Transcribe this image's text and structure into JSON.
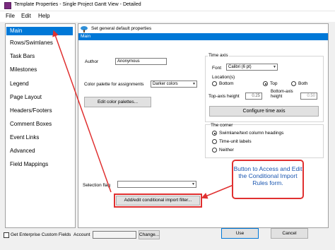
{
  "window": {
    "title": "Template Properties - Single Project Gantt View - Detailed"
  },
  "menu": {
    "file": "File",
    "edit": "Edit",
    "help": "Help"
  },
  "sidebar": {
    "items": [
      {
        "label": "Main"
      },
      {
        "label": "Rows/Swimlanes"
      },
      {
        "label": "Task Bars"
      },
      {
        "label": "Milestones"
      },
      {
        "label": "Legend"
      },
      {
        "label": "Page Layout"
      },
      {
        "label": "Headers/Footers"
      },
      {
        "label": "Comment Boxes"
      },
      {
        "label": "Event Links"
      },
      {
        "label": "Advanced"
      },
      {
        "label": "Field Mappings"
      }
    ],
    "selected": "Main"
  },
  "panel": {
    "header_text": "Set general default properties",
    "section_title": "Main",
    "author_label": "Author",
    "author_value": "Anonymous",
    "palette_label": "Color palette for assignments",
    "palette_value": "Darker colors",
    "edit_palettes_button": "Edit color palettes...",
    "selection_flag_label": "Selection flag",
    "selection_flag_value": "",
    "import_filter_button": "Add/edit conditional import filter..."
  },
  "time_axis": {
    "group_title": "Time axis",
    "font_label": "Font",
    "font_value": "Calibri (6 pt)",
    "location_label": "Location(s)",
    "loc_bottom": "Bottom",
    "loc_top": "Top",
    "loc_both": "Both",
    "loc_selected": "Top",
    "top_height_label": "Top-axis height",
    "top_height_value": "0.25",
    "bottom_height_label": "Bottom-axis height",
    "bottom_height_value": "0.50",
    "configure_button": "Configure time axis",
    "corner_title": "The corner",
    "corner_opt1": "Swimlane/text column headings",
    "corner_opt2": "Time-unit labels",
    "corner_opt3": "Neither",
    "corner_selected": "Swimlane/text column headings"
  },
  "callout": {
    "text": "Button to Access and Edit the Conditional Import Rules form."
  },
  "footer": {
    "enterprise_label": "Get Enterprise Custom Fields",
    "account_label": "Account",
    "account_value": "",
    "change_button": "Change...",
    "use_button": "Use",
    "cancel_button": "Cancel"
  },
  "colors": {
    "accent": "#0078d7",
    "callout_border": "#e03030",
    "callout_text": "#1a56b0"
  }
}
